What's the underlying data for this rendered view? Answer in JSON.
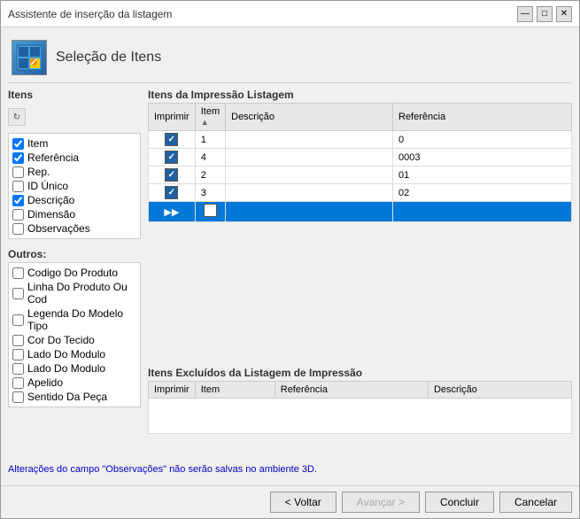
{
  "window": {
    "title": "Assistente de inserção da listagem"
  },
  "header": {
    "title": "Seleção de Itens"
  },
  "left_panel": {
    "section_label": "Itens",
    "items": [
      {
        "label": "Item",
        "checked": true
      },
      {
        "label": "Referência",
        "checked": true
      },
      {
        "label": "Rep.",
        "checked": false
      },
      {
        "label": "ID Único",
        "checked": false
      },
      {
        "label": "Descrição",
        "checked": true
      },
      {
        "label": "Dimensão",
        "checked": false
      },
      {
        "label": "Observações",
        "checked": false
      }
    ],
    "outros_label": "Outros:",
    "outros_items": [
      {
        "label": "Codigo Do Produto",
        "checked": false
      },
      {
        "label": "Linha Do Produto Ou Cod",
        "checked": false
      },
      {
        "label": "Legenda Do Modelo Tipo",
        "checked": false
      },
      {
        "label": "Cor Do Tecido",
        "checked": false
      },
      {
        "label": "Lado Do Modulo",
        "checked": false
      },
      {
        "label": "Lado Do Modulo",
        "checked": false
      },
      {
        "label": "Apelido",
        "checked": false
      },
      {
        "label": "Sentido Da Peça",
        "checked": false
      }
    ]
  },
  "items_section": {
    "label": "Itens da Impressão Listagem",
    "columns": [
      "Imprimir",
      "Item",
      "Descrição",
      "Referência"
    ],
    "rows": [
      {
        "imprimir": true,
        "item": "1",
        "descricao": "",
        "referencia": "0"
      },
      {
        "imprimir": true,
        "item": "4",
        "descricao": "",
        "referencia": "0003"
      },
      {
        "imprimir": true,
        "item": "2",
        "descricao": "",
        "referencia": "01"
      },
      {
        "imprimir": true,
        "item": "3",
        "descricao": "",
        "referencia": "02"
      }
    ],
    "new_row": {
      "imprimir": false,
      "item": "",
      "descricao": "",
      "referencia": ""
    }
  },
  "excluded_section": {
    "label": "Itens Excluídos da Listagem de Impressão",
    "columns": [
      "Imprimir",
      "Item",
      "Referência",
      "Descrição"
    ]
  },
  "footer": {
    "note": "Alterações do campo \"Observações\" não serão salvas no ambiente 3D.",
    "back_label": "< Voltar",
    "next_label": "Avançar >",
    "finish_label": "Concluir",
    "cancel_label": "Cancelar"
  }
}
